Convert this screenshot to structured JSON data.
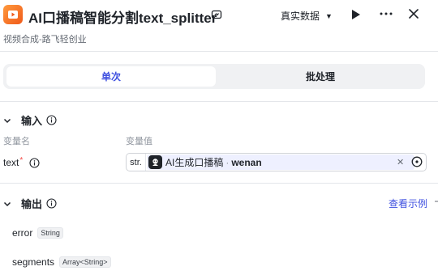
{
  "header": {
    "title": "AI口播稿智能分割text_splitter",
    "data_source": "真实数据",
    "icons": {
      "app": "play-card-icon",
      "edit": "edit-icon",
      "run": "run-icon",
      "more": "more-icon",
      "close": "close-icon"
    }
  },
  "subtitle": "视频合成-路飞轻创业",
  "tabs": [
    {
      "label": "单次",
      "active": true
    },
    {
      "label": "批处理",
      "active": false
    }
  ],
  "input": {
    "title": "输入",
    "col_name": "变量名",
    "col_value": "变量值",
    "variables": [
      {
        "name": "text",
        "required": "*",
        "type": "str.",
        "ref_node": "AI生成口播稿",
        "ref_var": "wenan"
      }
    ]
  },
  "output": {
    "title": "输出",
    "view_example": "查看示例",
    "fields": [
      {
        "name": "error",
        "type": "String"
      },
      {
        "name": "segments",
        "type": "Array<String>"
      }
    ]
  },
  "colors": {
    "accent": "#3e4fe0",
    "required": "#f54a45",
    "app_icon": "#f05a1a"
  }
}
